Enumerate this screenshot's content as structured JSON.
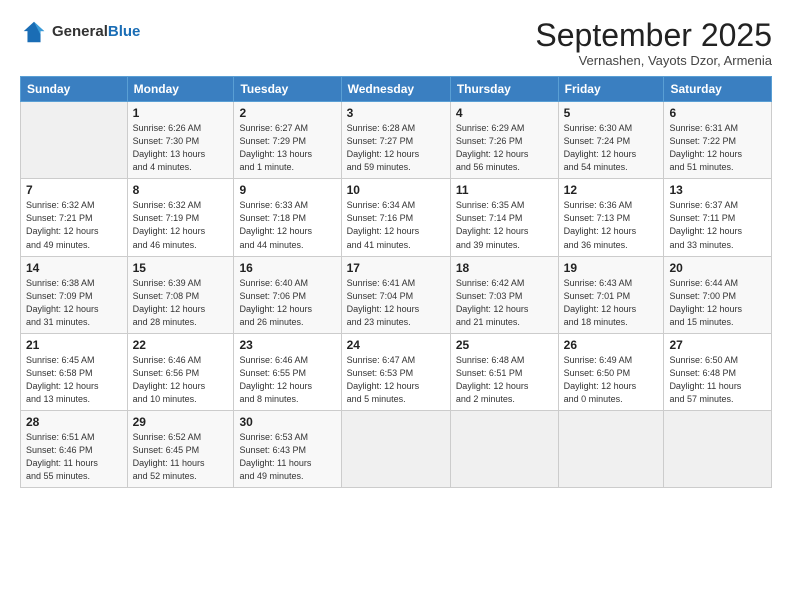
{
  "logo": {
    "general": "General",
    "blue": "Blue"
  },
  "header": {
    "month": "September 2025",
    "location": "Vernashen, Vayots Dzor, Armenia"
  },
  "days_of_week": [
    "Sunday",
    "Monday",
    "Tuesday",
    "Wednesday",
    "Thursday",
    "Friday",
    "Saturday"
  ],
  "weeks": [
    [
      {
        "day": "",
        "info": ""
      },
      {
        "day": "1",
        "info": "Sunrise: 6:26 AM\nSunset: 7:30 PM\nDaylight: 13 hours\nand 4 minutes."
      },
      {
        "day": "2",
        "info": "Sunrise: 6:27 AM\nSunset: 7:29 PM\nDaylight: 13 hours\nand 1 minute."
      },
      {
        "day": "3",
        "info": "Sunrise: 6:28 AM\nSunset: 7:27 PM\nDaylight: 12 hours\nand 59 minutes."
      },
      {
        "day": "4",
        "info": "Sunrise: 6:29 AM\nSunset: 7:26 PM\nDaylight: 12 hours\nand 56 minutes."
      },
      {
        "day": "5",
        "info": "Sunrise: 6:30 AM\nSunset: 7:24 PM\nDaylight: 12 hours\nand 54 minutes."
      },
      {
        "day": "6",
        "info": "Sunrise: 6:31 AM\nSunset: 7:22 PM\nDaylight: 12 hours\nand 51 minutes."
      }
    ],
    [
      {
        "day": "7",
        "info": "Sunrise: 6:32 AM\nSunset: 7:21 PM\nDaylight: 12 hours\nand 49 minutes."
      },
      {
        "day": "8",
        "info": "Sunrise: 6:32 AM\nSunset: 7:19 PM\nDaylight: 12 hours\nand 46 minutes."
      },
      {
        "day": "9",
        "info": "Sunrise: 6:33 AM\nSunset: 7:18 PM\nDaylight: 12 hours\nand 44 minutes."
      },
      {
        "day": "10",
        "info": "Sunrise: 6:34 AM\nSunset: 7:16 PM\nDaylight: 12 hours\nand 41 minutes."
      },
      {
        "day": "11",
        "info": "Sunrise: 6:35 AM\nSunset: 7:14 PM\nDaylight: 12 hours\nand 39 minutes."
      },
      {
        "day": "12",
        "info": "Sunrise: 6:36 AM\nSunset: 7:13 PM\nDaylight: 12 hours\nand 36 minutes."
      },
      {
        "day": "13",
        "info": "Sunrise: 6:37 AM\nSunset: 7:11 PM\nDaylight: 12 hours\nand 33 minutes."
      }
    ],
    [
      {
        "day": "14",
        "info": "Sunrise: 6:38 AM\nSunset: 7:09 PM\nDaylight: 12 hours\nand 31 minutes."
      },
      {
        "day": "15",
        "info": "Sunrise: 6:39 AM\nSunset: 7:08 PM\nDaylight: 12 hours\nand 28 minutes."
      },
      {
        "day": "16",
        "info": "Sunrise: 6:40 AM\nSunset: 7:06 PM\nDaylight: 12 hours\nand 26 minutes."
      },
      {
        "day": "17",
        "info": "Sunrise: 6:41 AM\nSunset: 7:04 PM\nDaylight: 12 hours\nand 23 minutes."
      },
      {
        "day": "18",
        "info": "Sunrise: 6:42 AM\nSunset: 7:03 PM\nDaylight: 12 hours\nand 21 minutes."
      },
      {
        "day": "19",
        "info": "Sunrise: 6:43 AM\nSunset: 7:01 PM\nDaylight: 12 hours\nand 18 minutes."
      },
      {
        "day": "20",
        "info": "Sunrise: 6:44 AM\nSunset: 7:00 PM\nDaylight: 12 hours\nand 15 minutes."
      }
    ],
    [
      {
        "day": "21",
        "info": "Sunrise: 6:45 AM\nSunset: 6:58 PM\nDaylight: 12 hours\nand 13 minutes."
      },
      {
        "day": "22",
        "info": "Sunrise: 6:46 AM\nSunset: 6:56 PM\nDaylight: 12 hours\nand 10 minutes."
      },
      {
        "day": "23",
        "info": "Sunrise: 6:46 AM\nSunset: 6:55 PM\nDaylight: 12 hours\nand 8 minutes."
      },
      {
        "day": "24",
        "info": "Sunrise: 6:47 AM\nSunset: 6:53 PM\nDaylight: 12 hours\nand 5 minutes."
      },
      {
        "day": "25",
        "info": "Sunrise: 6:48 AM\nSunset: 6:51 PM\nDaylight: 12 hours\nand 2 minutes."
      },
      {
        "day": "26",
        "info": "Sunrise: 6:49 AM\nSunset: 6:50 PM\nDaylight: 12 hours\nand 0 minutes."
      },
      {
        "day": "27",
        "info": "Sunrise: 6:50 AM\nSunset: 6:48 PM\nDaylight: 11 hours\nand 57 minutes."
      }
    ],
    [
      {
        "day": "28",
        "info": "Sunrise: 6:51 AM\nSunset: 6:46 PM\nDaylight: 11 hours\nand 55 minutes."
      },
      {
        "day": "29",
        "info": "Sunrise: 6:52 AM\nSunset: 6:45 PM\nDaylight: 11 hours\nand 52 minutes."
      },
      {
        "day": "30",
        "info": "Sunrise: 6:53 AM\nSunset: 6:43 PM\nDaylight: 11 hours\nand 49 minutes."
      },
      {
        "day": "",
        "info": ""
      },
      {
        "day": "",
        "info": ""
      },
      {
        "day": "",
        "info": ""
      },
      {
        "day": "",
        "info": ""
      }
    ]
  ]
}
